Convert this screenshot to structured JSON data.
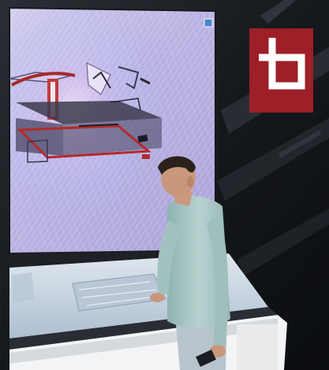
{
  "scene": {
    "colors": {
      "background_dark": "#1a1d22",
      "screen_glow": "#b4aedc",
      "logo_red": "#9d1f27",
      "logo_white": "#ffffff",
      "table_surface": "#c9d6e2",
      "person_shirt": "#a9c7c4",
      "person_hair": "#2a211b"
    },
    "icons": {
      "logo": "bracket-logo-icon",
      "corner_badge": "square-badge-icon"
    }
  }
}
